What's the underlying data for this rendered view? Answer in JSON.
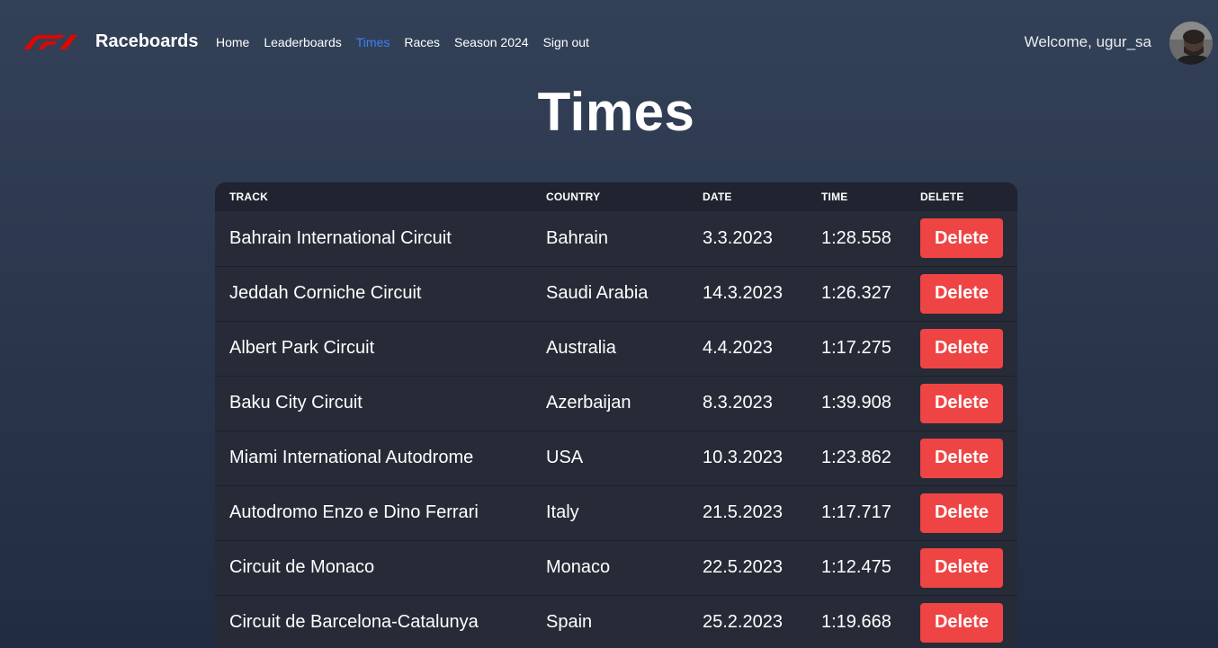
{
  "nav": {
    "brand": "Raceboards",
    "links": [
      {
        "label": "Home",
        "active": false
      },
      {
        "label": "Leaderboards",
        "active": false
      },
      {
        "label": "Times",
        "active": true
      },
      {
        "label": "Races",
        "active": false
      },
      {
        "label": "Season 2024",
        "active": false
      },
      {
        "label": "Sign out",
        "active": false
      }
    ],
    "welcome": "Welcome, ugur_sa",
    "accent_color": "#3b82f6",
    "logo_icon": "f1-logo-icon"
  },
  "page": {
    "title": "Times"
  },
  "table": {
    "headers": [
      "TRACK",
      "COUNTRY",
      "DATE",
      "TIME",
      "DELETE"
    ],
    "delete_label": "Delete",
    "delete_color": "#ef4444",
    "rows": [
      {
        "track": "Bahrain International Circuit",
        "country": "Bahrain",
        "date": "3.3.2023",
        "time": "1:28.558"
      },
      {
        "track": "Jeddah Corniche Circuit",
        "country": "Saudi Arabia",
        "date": "14.3.2023",
        "time": "1:26.327"
      },
      {
        "track": "Albert Park Circuit",
        "country": "Australia",
        "date": "4.4.2023",
        "time": "1:17.275"
      },
      {
        "track": "Baku City Circuit",
        "country": "Azerbaijan",
        "date": "8.3.2023",
        "time": "1:39.908"
      },
      {
        "track": "Miami International Autodrome",
        "country": "USA",
        "date": "10.3.2023",
        "time": "1:23.862"
      },
      {
        "track": "Autodromo Enzo e Dino Ferrari",
        "country": "Italy",
        "date": "21.5.2023",
        "time": "1:17.717"
      },
      {
        "track": "Circuit de Monaco",
        "country": "Monaco",
        "date": "22.5.2023",
        "time": "1:12.475"
      },
      {
        "track": "Circuit de Barcelona-Catalunya",
        "country": "Spain",
        "date": "25.2.2023",
        "time": "1:19.668"
      }
    ]
  }
}
